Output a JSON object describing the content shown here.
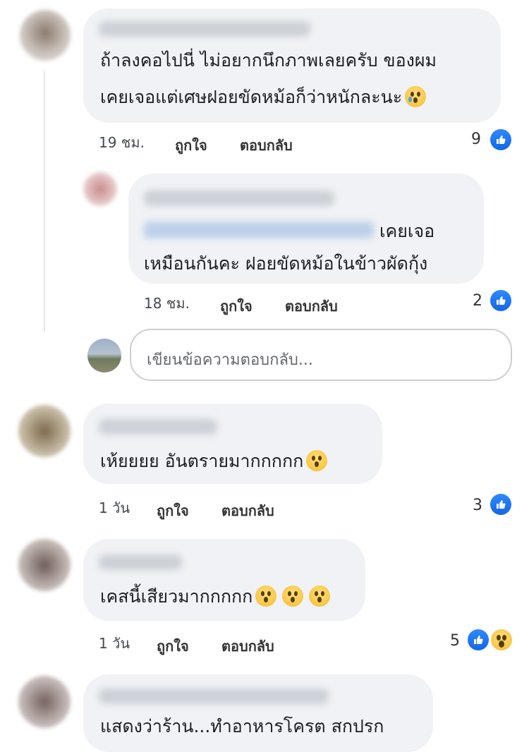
{
  "comments": [
    {
      "text_line1": "ถ้าลงคอไปนี่ ไม่อยากนึกภาพเลยครับ ของผม",
      "text_line2": "เคยเจอแต่เศษฝอยขัดหม้อก็ว่าหนักละนะ",
      "emoji": "crying-face-emoji",
      "time": "19 ชม.",
      "like_label": "ถูกใจ",
      "reply_label": "ตอบกลับ",
      "reaction_count": "9"
    },
    {
      "text_line1": "เคยเจอ",
      "text_line2": "เหมือนกันคะ ฝอยขัดหม้อในข้าวผัดกุ้ง",
      "time": "18 ชม.",
      "like_label": "ถูกใจ",
      "reply_label": "ตอบกลับ",
      "reaction_count": "2"
    },
    {
      "text": "เห้ยยยย อันตรายมากกกกก",
      "time": "1 วัน",
      "like_label": "ถูกใจ",
      "reply_label": "ตอบกลับ",
      "reaction_count": "3"
    },
    {
      "text": "เคสนี้เสียวมากกกกก",
      "time": "1 วัน",
      "like_label": "ถูกใจ",
      "reply_label": "ตอบกลับ",
      "reaction_count": "5"
    },
    {
      "text": "แสดงว่าร้าน...ทำอาหารโครต สกปรก"
    }
  ],
  "reply_box": {
    "placeholder": "เขียนข้อความตอบกลับ..."
  },
  "colors": {
    "bubble": "#f0f2f5",
    "like_blue": "#1877f2",
    "meta_text": "#444950"
  },
  "icons": {
    "like": "thumbs-up-icon",
    "wow": "wow-face-icon",
    "crying": "crying-face-emoji",
    "astonished": "astonished-face-emoji"
  }
}
